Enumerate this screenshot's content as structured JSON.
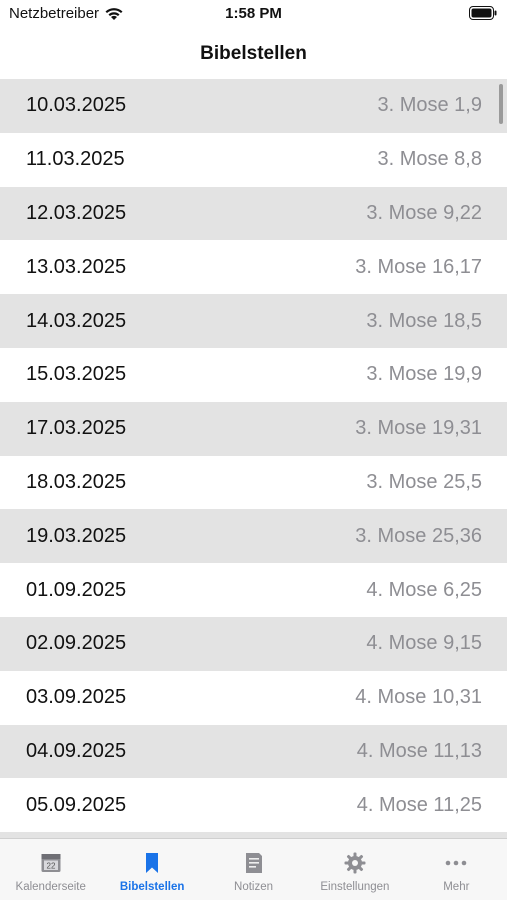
{
  "status": {
    "carrier": "Netzbetreiber",
    "time": "1:58 PM"
  },
  "nav": {
    "title": "Bibelstellen"
  },
  "rows": [
    {
      "date": "10.03.2025",
      "ref": "3. Mose 1,9"
    },
    {
      "date": "11.03.2025",
      "ref": "3. Mose 8,8"
    },
    {
      "date": "12.03.2025",
      "ref": "3. Mose 9,22"
    },
    {
      "date": "13.03.2025",
      "ref": "3. Mose 16,17"
    },
    {
      "date": "14.03.2025",
      "ref": "3. Mose 18,5"
    },
    {
      "date": "15.03.2025",
      "ref": "3. Mose 19,9"
    },
    {
      "date": "17.03.2025",
      "ref": "3. Mose 19,31"
    },
    {
      "date": "18.03.2025",
      "ref": "3. Mose 25,5"
    },
    {
      "date": "19.03.2025",
      "ref": "3. Mose 25,36"
    },
    {
      "date": "01.09.2025",
      "ref": "4. Mose 6,25"
    },
    {
      "date": "02.09.2025",
      "ref": "4. Mose 9,15"
    },
    {
      "date": "03.09.2025",
      "ref": "4. Mose 10,31"
    },
    {
      "date": "04.09.2025",
      "ref": "4. Mose 11,13"
    },
    {
      "date": "05.09.2025",
      "ref": "4. Mose 11,25"
    }
  ],
  "tabs": [
    {
      "label": "Kalenderseite",
      "icon": "calendar-icon",
      "active": false
    },
    {
      "label": "Bibelstellen",
      "icon": "bookmark-icon",
      "active": true
    },
    {
      "label": "Notizen",
      "icon": "notes-icon",
      "active": false
    },
    {
      "label": "Einstellungen",
      "icon": "gear-icon",
      "active": false
    },
    {
      "label": "Mehr",
      "icon": "more-icon",
      "active": false
    }
  ],
  "calendar_icon_day": "22",
  "colors": {
    "accent": "#1a73e8",
    "row_alt": "#e3e3e3",
    "secondary_text": "#8e8e93"
  }
}
